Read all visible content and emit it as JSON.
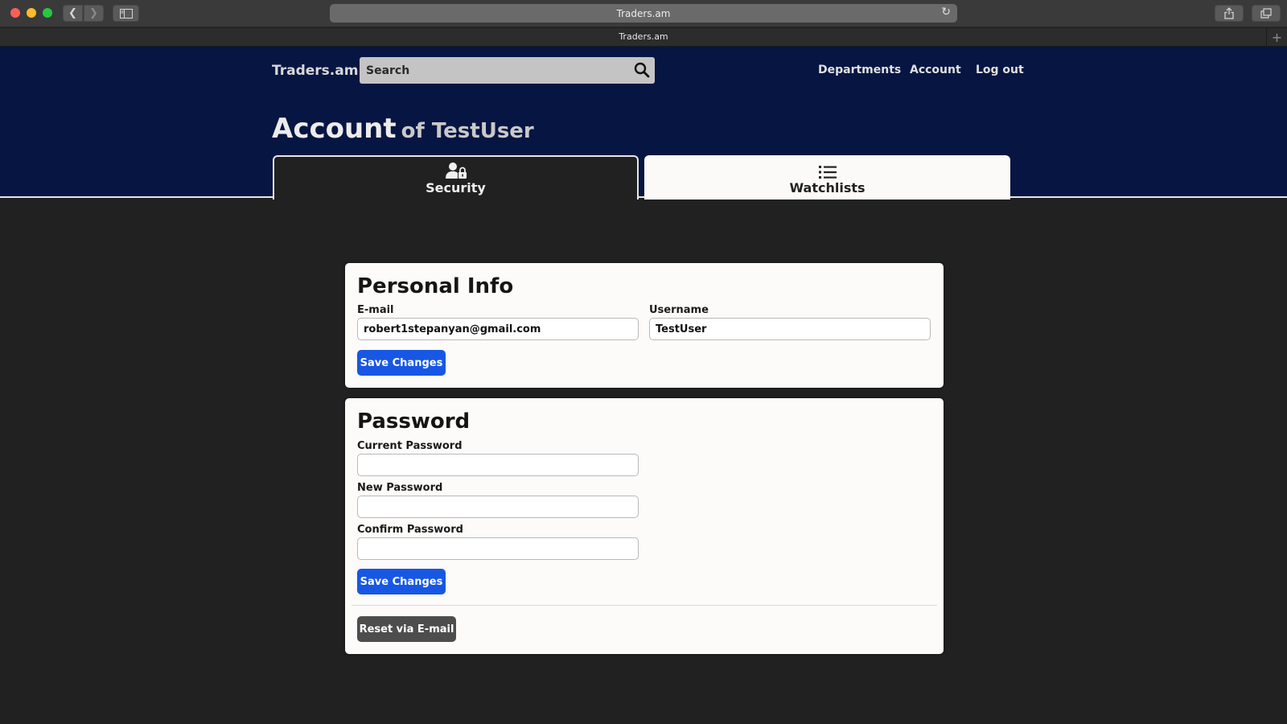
{
  "browser": {
    "url": "Traders.am",
    "tab_title": "Traders.am",
    "new_tab": "+"
  },
  "header": {
    "brand": "Traders.am",
    "search_placeholder": "Search",
    "nav": {
      "departments": "Departments",
      "account": "Account",
      "logout": "Log out"
    }
  },
  "page": {
    "title": "Account",
    "subtitle": "of TestUser"
  },
  "tabs": {
    "security": "Security",
    "watchlists": "Watchlists",
    "active": "security"
  },
  "personal_info": {
    "title": "Personal Info",
    "email_label": "E-mail",
    "email_value": "robert1stepanyan@gmail.com",
    "username_label": "Username",
    "username_value": "TestUser",
    "save_label": "Save Changes"
  },
  "password": {
    "title": "Password",
    "current_label": "Current Password",
    "new_label": "New Password",
    "confirm_label": "Confirm Password",
    "save_label": "Save Changes",
    "reset_label": "Reset via E-mail"
  },
  "colors": {
    "header_bg": "#071542",
    "page_bg": "#212121",
    "primary_button": "#1857e3",
    "dark_button": "#4d4d4d"
  },
  "icons": {
    "search": "search-icon",
    "security": "user-lock-icon",
    "watchlists": "list-icon"
  }
}
